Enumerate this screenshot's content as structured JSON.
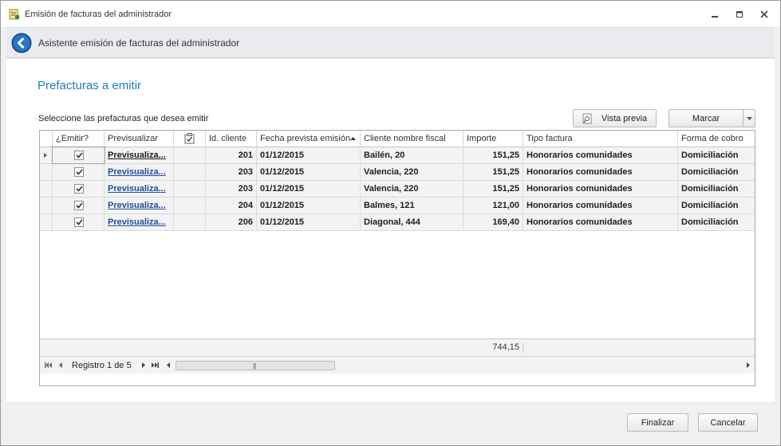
{
  "window": {
    "title": "Emisión de facturas del administrador"
  },
  "wizard": {
    "header_title": "Asistente emisión de facturas del administrador"
  },
  "page": {
    "title": "Prefacturas a emitir",
    "subtitle": "Seleccione las prefacturas que desea emitir"
  },
  "toolbar": {
    "preview_label": "Vista previa",
    "mark_label": "Marcar"
  },
  "grid": {
    "columns": [
      "¿Emitir?",
      "Previsualizar",
      "",
      "Id. cliente",
      "Fecha prevista emisión",
      "Cliente nombre fiscal",
      "Importe",
      "Tipo factura",
      "Forma de cobro"
    ],
    "sort_column": "Fecha prevista emisión",
    "sort_direction": "ascending",
    "rows": [
      {
        "emitir": true,
        "preview": "Previsualiza...",
        "id": "201",
        "fecha": "01/12/2015",
        "cliente": "Bailén, 20",
        "importe": "151,25",
        "tipo": "Honorarios comunidades",
        "forma": "Domiciliación"
      },
      {
        "emitir": true,
        "preview": "Previsualiza...",
        "id": "203",
        "fecha": "01/12/2015",
        "cliente": "Valencia, 220",
        "importe": "151,25",
        "tipo": "Honorarios comunidades",
        "forma": "Domiciliación"
      },
      {
        "emitir": true,
        "preview": "Previsualiza...",
        "id": "203",
        "fecha": "01/12/2015",
        "cliente": "Valencia, 220",
        "importe": "151,25",
        "tipo": "Honorarios comunidades",
        "forma": "Domiciliación"
      },
      {
        "emitir": true,
        "preview": "Previsualiza...",
        "id": "204",
        "fecha": "01/12/2015",
        "cliente": "Balmes, 121",
        "importe": "121,00",
        "tipo": "Honorarios comunidades",
        "forma": "Domiciliación"
      },
      {
        "emitir": true,
        "preview": "Previsualiza...",
        "id": "206",
        "fecha": "01/12/2015",
        "cliente": "Diagonal, 444",
        "importe": "169,40",
        "tipo": "Honorarios comunidades",
        "forma": "Domiciliación"
      }
    ],
    "total_importe": "744,15",
    "navigator_text": "Registro 1 de 5"
  },
  "buttons": {
    "finish": "Finalizar",
    "cancel": "Cancelar"
  },
  "colors": {
    "accent": "#1f7bbd",
    "link": "#1d4fa0"
  }
}
